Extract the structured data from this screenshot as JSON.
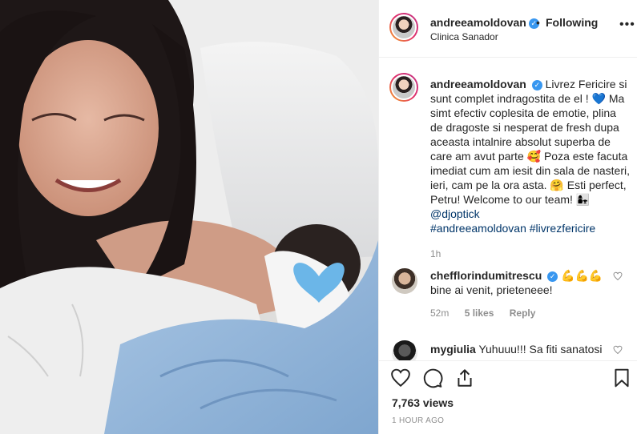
{
  "post": {
    "username": "andreeamoldovan",
    "verified_mark": "✓",
    "separator": "•",
    "follow_status": "Following",
    "location": "Clinica Sanador",
    "more_label": "•••"
  },
  "caption": {
    "username": "andreeamoldovan",
    "text_1": "Livrez Fericire si sunt complet indragostita de el !",
    "emoji_heart": "💙",
    "text_2": "Ma simt efectiv coplesita de emotie, plina de dragoste si nesperat de fresh dupa aceasta intalnire absolut superba de care am avut parte",
    "emoji_love": "🥰",
    "text_3": "Poza este facuta imediat cum am iesit din sala de nasteri, ieri, cam pe la ora asta.",
    "emoji_hug": "🤗",
    "text_4": "Esti perfect, Petru! Welcome to our team!",
    "emoji_family": "👩‍👧",
    "mention": "@djoptick",
    "hashtags": "#andreeamoldovan #livrezfericire",
    "time": "1h"
  },
  "comments": [
    {
      "username": "chefflorindumitrescu",
      "emoji": "💪💪💪",
      "text": "bine ai venit, prieteneee!",
      "time": "52m",
      "likes": "5 likes",
      "reply": "Reply"
    },
    {
      "username": "mygiulia",
      "text": "Yuhuuu!!! Sa fiti sanatosi"
    }
  ],
  "footer": {
    "views": "7,763 views",
    "time": "1 HOUR AGO"
  },
  "icons": {
    "like": "heart-icon",
    "comment": "comment-icon",
    "share": "share-icon",
    "save": "bookmark-icon",
    "comment_like": "small-heart-icon"
  },
  "colors": {
    "verified": "#3897f0",
    "link": "#003569",
    "muted": "#8e8e8e",
    "text": "#262626"
  }
}
